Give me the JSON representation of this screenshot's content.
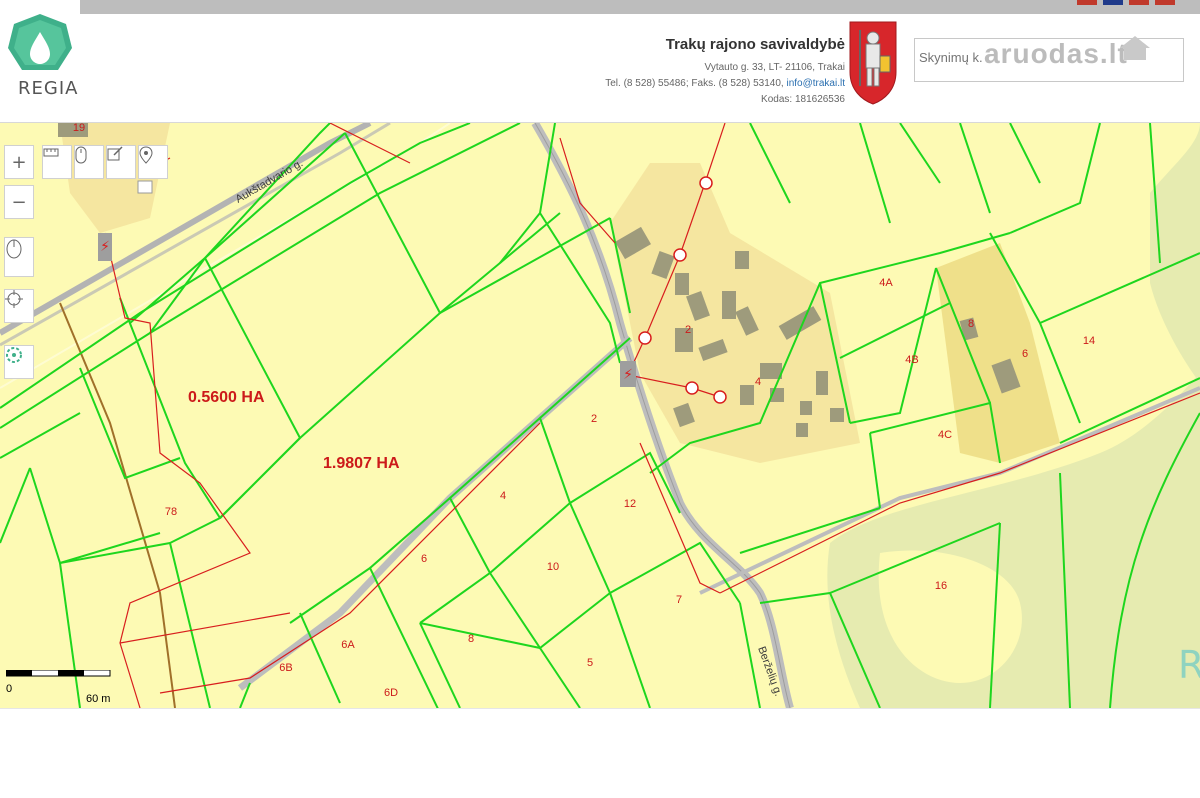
{
  "app": {
    "logo_text": "REGIA",
    "watermark": "aruodas.lt"
  },
  "municipality": {
    "name": "Trakų rajono savivaldybė",
    "address": "Vytauto g. 33, LT- 21106, Trakai",
    "phone_fax": "Tel. (8 528) 55486; Faks. (8 528) 53140,",
    "email": "info@trakai.lt",
    "code": "Kodas: 181626536"
  },
  "search": {
    "placeholder": "Skynimų k."
  },
  "map": {
    "street_labels": [
      "Aukštadvario g.",
      "Berželių g."
    ],
    "area_labels": [
      "0.5600 HA",
      "1.9807 HA"
    ],
    "parcel_labels": [
      "19",
      "78",
      "2",
      "4",
      "6",
      "6A",
      "6B",
      "6D",
      "8",
      "10",
      "12",
      "7",
      "5",
      "2",
      "4",
      "4A",
      "4B",
      "4C",
      "8",
      "6",
      "14",
      "16"
    ],
    "scale": {
      "zero": "0",
      "distance": "60 m"
    },
    "colors": {
      "background": "#fdfab4",
      "parcel_border": "#1ed61e",
      "label": "#cc1a1a",
      "settlement": "#f5e6a0",
      "forest": "#e6ebb0",
      "road": "#bdbdbd",
      "power_line": "#d81e1e"
    }
  },
  "icons": {
    "zoom_in": "plus-icon",
    "zoom_out": "minus-icon",
    "measure": "ruler-icon",
    "mouse": "mouse-icon",
    "edit": "edit-icon",
    "locate": "marker-icon",
    "orient": "compass-icon",
    "gps": "crosshair-icon",
    "layers": "layers-icon"
  }
}
